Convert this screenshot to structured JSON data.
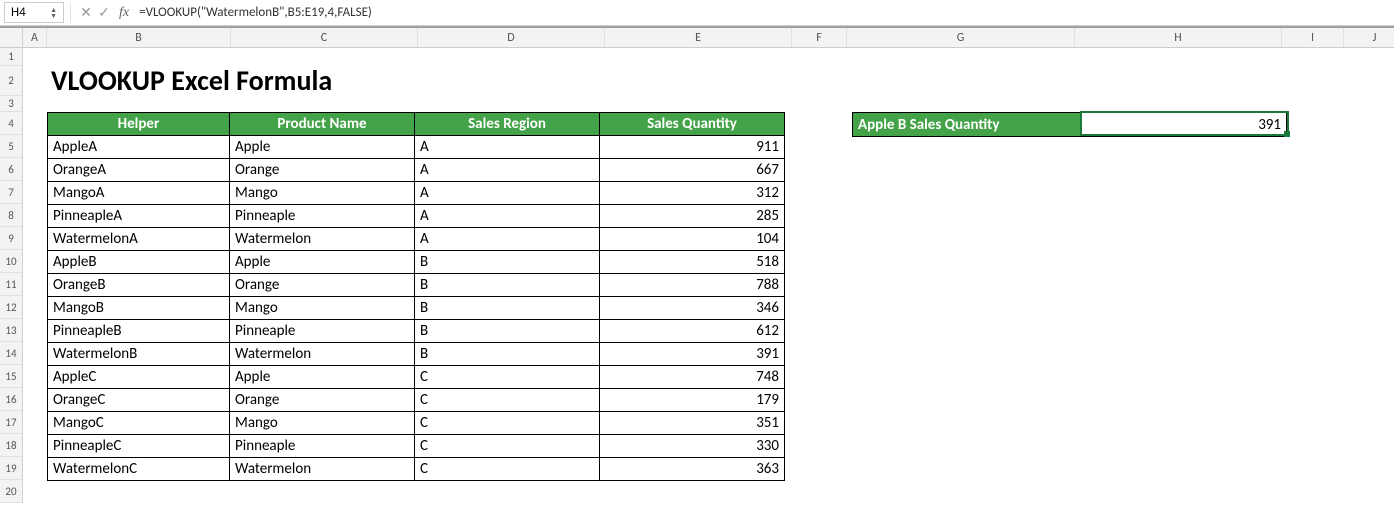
{
  "formula_bar": {
    "cell_ref": "H4",
    "formula": "=VLOOKUP(\"WatermelonB\",B5:E19,4,FALSE)"
  },
  "columns": [
    "A",
    "B",
    "C",
    "D",
    "E",
    "F",
    "G",
    "H",
    "I",
    "J"
  ],
  "row_count": 20,
  "title": "VLOOKUP Excel Formula",
  "table": {
    "headers": [
      "Helper",
      "Product Name",
      "Sales Region",
      "Sales Quantity"
    ],
    "rows": [
      {
        "helper": "AppleA",
        "product": "Apple",
        "region": "A",
        "qty": "911"
      },
      {
        "helper": "OrangeA",
        "product": "Orange",
        "region": "A",
        "qty": "667"
      },
      {
        "helper": "MangoA",
        "product": "Mango",
        "region": "A",
        "qty": "312"
      },
      {
        "helper": "PinneapleA",
        "product": "Pinneaple",
        "region": "A",
        "qty": "285"
      },
      {
        "helper": "WatermelonA",
        "product": "Watermelon",
        "region": "A",
        "qty": "104"
      },
      {
        "helper": "AppleB",
        "product": "Apple",
        "region": "B",
        "qty": "518"
      },
      {
        "helper": "OrangeB",
        "product": "Orange",
        "region": "B",
        "qty": "788"
      },
      {
        "helper": "MangoB",
        "product": "Mango",
        "region": "B",
        "qty": "346"
      },
      {
        "helper": "PinneapleB",
        "product": "Pinneaple",
        "region": "B",
        "qty": "612"
      },
      {
        "helper": "WatermelonB",
        "product": "Watermelon",
        "region": "B",
        "qty": "391"
      },
      {
        "helper": "AppleC",
        "product": "Apple",
        "region": "C",
        "qty": "748"
      },
      {
        "helper": "OrangeC",
        "product": "Orange",
        "region": "C",
        "qty": "179"
      },
      {
        "helper": "MangoC",
        "product": "Mango",
        "region": "C",
        "qty": "351"
      },
      {
        "helper": "PinneapleC",
        "product": "Pinneaple",
        "region": "C",
        "qty": "330"
      },
      {
        "helper": "WatermelonC",
        "product": "Watermelon",
        "region": "C",
        "qty": "363"
      }
    ]
  },
  "lookup": {
    "label": "Apple B Sales Quantity",
    "value": "391"
  }
}
